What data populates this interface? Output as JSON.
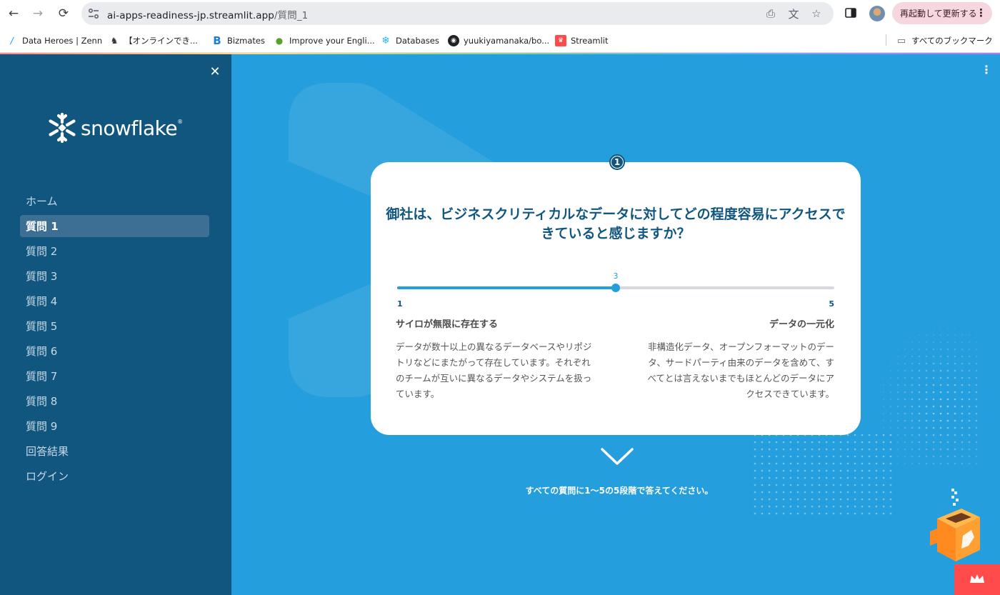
{
  "browser": {
    "url_host": "ai-apps-readiness-jp.streamlit.app",
    "url_path": "/質問_1",
    "update_button": "再起動して更新する",
    "bookmarks": [
      {
        "label": "Data Heroes | Zenn",
        "icon": "zenn-icon",
        "color": "#3ea8ff"
      },
      {
        "label": "【オンラインでき...",
        "icon": "avatar-icon",
        "color": "#333333"
      },
      {
        "label": "Bizmates",
        "icon": "bizmates-icon",
        "color": "#1f7ed8"
      },
      {
        "label": "Improve your Engli...",
        "icon": "people-icon",
        "color": "#5aa02c"
      },
      {
        "label": "Databases",
        "icon": "snowflake-icon",
        "color": "#29b5e8"
      },
      {
        "label": "yuukiyamanaka/bo...",
        "icon": "github-icon",
        "color": "#202124"
      },
      {
        "label": "Streamlit",
        "icon": "streamlit-icon",
        "color": "#ff4b4b"
      }
    ],
    "all_bookmarks": "すべてのブックマーク"
  },
  "sidebar": {
    "brand": "snowflake",
    "brand_mark": "®",
    "nav": [
      {
        "label": "ホーム",
        "active": false
      },
      {
        "label": "質問 1",
        "active": true
      },
      {
        "label": "質問 2",
        "active": false
      },
      {
        "label": "質問 3",
        "active": false
      },
      {
        "label": "質問 4",
        "active": false
      },
      {
        "label": "質問 5",
        "active": false
      },
      {
        "label": "質問 6",
        "active": false
      },
      {
        "label": "質問 7",
        "active": false
      },
      {
        "label": "質問 8",
        "active": false
      },
      {
        "label": "質問 9",
        "active": false
      },
      {
        "label": "回答結果",
        "active": false
      },
      {
        "label": "ログイン",
        "active": false
      }
    ]
  },
  "question": {
    "number": "1",
    "text": "御社は、ビジネスクリティカルなデータに対してどの程度容易にアクセスできていると感じますか？",
    "slider": {
      "min": 1,
      "max": 5,
      "value": 3,
      "min_label": "1",
      "max_label": "5",
      "value_label": "3"
    },
    "left_title": "サイロが無限に存在する",
    "left_desc": "データが数十以上の異なるデータベースやリポジトリなどにまたがって存在しています。それぞれのチームが互いに異なるデータやシステムを扱っています。",
    "right_title": "データの一元化",
    "right_desc": "非構造化データ、オープンフォーマットのデータ、サードパーティ由来のデータを含めて、すべてとは言えないまでもほとんどのデータにアクセスできています。"
  },
  "instruction": "すべての質問に1〜5の5段階で答えてください。",
  "colors": {
    "sidebar_bg": "#11567f",
    "main_bg": "#249edc",
    "accent": "#249edc",
    "heading": "#11567f",
    "streamlit_red": "#ff4b4b"
  }
}
